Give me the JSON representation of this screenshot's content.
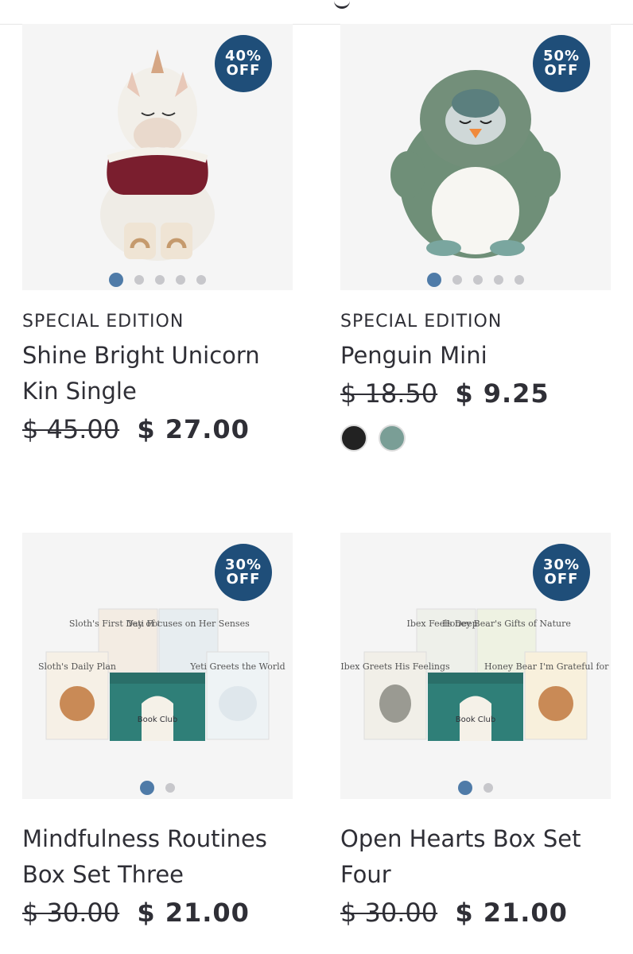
{
  "products": [
    {
      "badge": {
        "pct": "40%",
        "off": "OFF"
      },
      "eyebrow": "SPECIAL EDITION",
      "title_line1": "Shine Bright Unicorn",
      "title_line2": "Kin Single",
      "old_price": "$ 45.00",
      "new_price": "$ 27.00",
      "image_dots": 5,
      "active_dot": 0
    },
    {
      "badge": {
        "pct": "50%",
        "off": "OFF"
      },
      "eyebrow": "SPECIAL EDITION",
      "title_line1": "Penguin Mini",
      "title_line2": "",
      "old_price": "$ 18.50",
      "new_price": "$ 9.25",
      "image_dots": 5,
      "active_dot": 0,
      "swatches": [
        "#222222",
        "#7a9e96"
      ]
    },
    {
      "badge": {
        "pct": "30%",
        "off": "OFF"
      },
      "eyebrow": "",
      "title_line1": "Mindfulness Routines",
      "title_line2": "Box Set Three",
      "old_price": "$ 30.00",
      "new_price": "$ 21.00",
      "image_dots": 2,
      "active_dot": 0,
      "books": [
        "Sloth's Daily Plan",
        "Sloth's First Day of School",
        "Yeti Focuses on Her Senses",
        "Yeti Greets the World"
      ],
      "box_label": "Book Club"
    },
    {
      "badge": {
        "pct": "30%",
        "off": "OFF"
      },
      "eyebrow": "",
      "title_line1": "Open Hearts Box Set",
      "title_line2": "Four",
      "old_price": "$ 30.00",
      "new_price": "$ 21.00",
      "image_dots": 2,
      "active_dot": 0,
      "books": [
        "Ibex Greets His Feelings",
        "Ibex Feels Deeply",
        "Honey Bear's Gifts of Nature",
        "Honey Bear I'm Grateful for You"
      ],
      "box_label": "Book Club"
    }
  ],
  "colors": {
    "badge": "#1f4e79",
    "dot_active": "#4f7ba8",
    "dot": "#c7c7cb",
    "text": "#2f2f36"
  }
}
